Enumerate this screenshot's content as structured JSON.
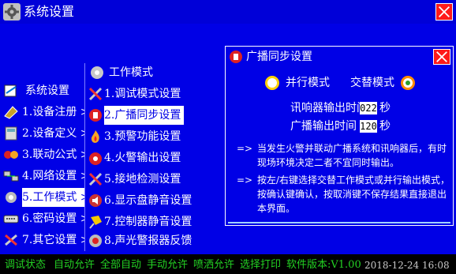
{
  "window": {
    "title": "系统设置"
  },
  "left_menu": {
    "header": "系统设置",
    "items": [
      {
        "label": "1.设备注册 >>"
      },
      {
        "label": "2.设备定义 >>"
      },
      {
        "label": "3.联动公式 >>"
      },
      {
        "label": "4.网络设置 >>"
      },
      {
        "label": "5.工作模式 >>"
      },
      {
        "label": "6.密码设置 >>"
      },
      {
        "label": "7.其它设置 >>"
      }
    ],
    "selected_index": 4
  },
  "submenu": {
    "header": "工作模式",
    "items": [
      {
        "label": "1.调试模式设置"
      },
      {
        "label": "2.广播同步设置"
      },
      {
        "label": "3.预警功能设置"
      },
      {
        "label": "4.火警输出设置"
      },
      {
        "label": "5.接地检测设置"
      },
      {
        "label": "6.显示盘静音设置"
      },
      {
        "label": "7.控制器静音设置"
      },
      {
        "label": "8.声光警报器反馈"
      }
    ],
    "selected_index": 1
  },
  "dialog": {
    "title": "广播同步设置",
    "option_parallel": "并行模式",
    "option_alternate": "交替模式",
    "selected_option": "交替模式",
    "sounder_output_label": "讯响器输出时间",
    "sounder_output_value": "022",
    "sounder_output_unit": "秒",
    "broadcast_output_label": "广播输出时间",
    "broadcast_output_value": "120",
    "broadcast_output_unit": "秒",
    "note1_arrow": "=>",
    "note1_line1": "当发生火警并联动广播系统和讯响器后，有时",
    "note1_line2": "现场环境决定二者不宜同时输出。",
    "note2_arrow": "=>",
    "note2_line1": "按左/右键选择交替工作模式或并行输出模式，",
    "note2_line2": "按确认键确认，按取消键不保存结果直接退出",
    "note2_line3": "本界面。"
  },
  "status_bar": {
    "debug_status": "调试状态",
    "auto_allow": "自动允许",
    "all_auto": "全部自动",
    "manual_allow": "手动允许",
    "spray_allow": "喷洒允许",
    "select_print": "选择打印",
    "software_version": "软件版本:V1.00",
    "datetime": "2018-12-24 16:08"
  },
  "colors": {
    "background": "#0000e6",
    "status_green": "#23d123",
    "close_red": "#ff1a1a"
  }
}
